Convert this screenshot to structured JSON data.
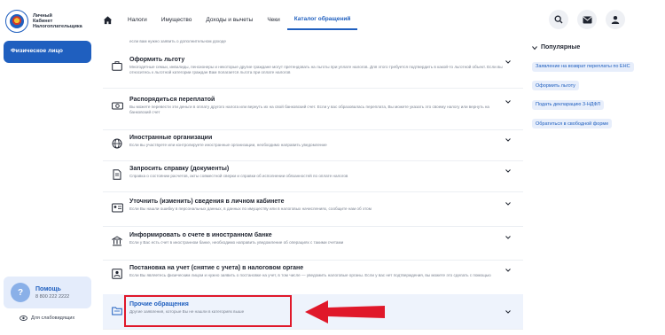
{
  "logo": {
    "line1": "Личный",
    "line2": "Кабинет",
    "line3": "Налогоплательщика"
  },
  "nav": {
    "items": [
      "Налоги",
      "Имущество",
      "Доходы и вычеты",
      "Чеки",
      "Каталог обращений"
    ],
    "active": "Каталог обращений"
  },
  "sidebar": {
    "card_label": "Физическое лицо",
    "help_title": "Помощь",
    "help_phone": "8 800 222 2222",
    "accessibility": "Для слабовидящих"
  },
  "list": {
    "top_desc": "если вам нужно заявить о дополнительном доходе",
    "rows": [
      {
        "icon": "briefcase-icon",
        "title": "Оформить льготу",
        "desc": "Многодетные семьи, инвалиды, пенсионеры и некоторые другие граждане могут претендовать на льготы при уплате налогов. Для этого требуется подтвердить в какой-то льготной объект. Если вы относитесь к льготной категории граждан Вам полагается льгота при оплате налогов"
      },
      {
        "icon": "money-icon",
        "title": "Распорядиться переплатой",
        "desc": "Вы можете перевести эти деньги в оплату другого налога или вернуть их на свой банковский счет. Если у вас образовалась переплата, Вы можете указать это своему налогу или вернуть на банковский счет"
      },
      {
        "icon": "globe-icon",
        "title": "Иностранные организации",
        "desc": "Если вы участвуете или контролируете иностранные организации, необходимо направить уведомление"
      },
      {
        "icon": "document-icon",
        "title": "Запросить справку (документы)",
        "desc": "Справка о состоянии расчетов, акты совместной сверки и справки об исполнении обязанностей по оплате налогов"
      },
      {
        "icon": "id-card-icon",
        "title": "Уточнить (изменить) сведения в личном кабинете",
        "desc": "Если Вы нашли ошибку в персональных данных, в данных по имуществу или в налоговых начислениях, сообщите нам об этом"
      },
      {
        "icon": "bank-icon",
        "title": "Информировать о счете в иностранном банке",
        "desc": "Если у Вас есть счет в иностранном банке, необходимо направить уведомление об операциях с такими счетами"
      },
      {
        "icon": "person-doc-icon",
        "title": "Постановка на учет (снятие с учета) в налоговом органе",
        "desc": "Если Вы являетесь физическим лицом и нужно заявить о постановке на учет, в том числе — уведомить налоговые органы. Если у вас нет подтверждения, вы можете это сделать с помощью"
      },
      {
        "icon": "folder-icon",
        "title": "Прочие обращения",
        "desc": "Другие заявления, которые Вы не нашли в категориях выше"
      }
    ]
  },
  "popular": {
    "title": "Популярные",
    "chips": [
      "Заявление на возврат переплаты по ЕНС",
      "Оформить льготу",
      "Подать декларацию 3-НДФЛ",
      "Обратиться в свободной форме"
    ]
  },
  "colors": {
    "accent": "#1f5fbf",
    "annotation": "#e0182a"
  }
}
